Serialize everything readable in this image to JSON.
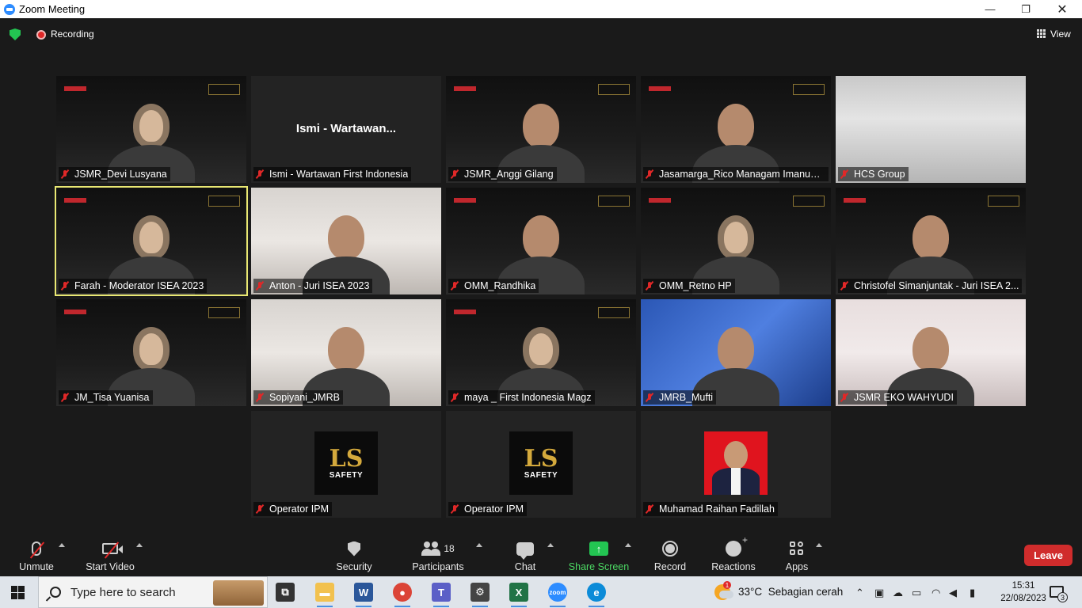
{
  "window": {
    "title": "Zoom Meeting",
    "minimize": "—",
    "maximize": "❐",
    "close": "✕"
  },
  "topbar": {
    "recording_label": "Recording",
    "view_label": "View"
  },
  "participants": [
    {
      "name": "JSMR_Devi Lusyana",
      "style": "video"
    },
    {
      "name": "Ismi - Wartawan First Indonesia",
      "style": "plain",
      "center_text": "Ismi - Wartawan..."
    },
    {
      "name": "JSMR_Anggi Gilang",
      "style": "video"
    },
    {
      "name": "Jasamarga_Rico Managam Imanuel...",
      "style": "video"
    },
    {
      "name": "HCS Group",
      "style": "room"
    },
    {
      "name": "Farah - Moderator ISEA 2023",
      "style": "video",
      "active": true
    },
    {
      "name": "Anton - Juri ISEA 2023",
      "style": "light"
    },
    {
      "name": "OMM_Randhika",
      "style": "video"
    },
    {
      "name": "OMM_Retno HP",
      "style": "video"
    },
    {
      "name": "Christofel Simanjuntak - Juri ISEA 2...",
      "style": "video"
    },
    {
      "name": "JM_Tisa Yuanisa",
      "style": "video"
    },
    {
      "name": "Sopiyani_JMRB",
      "style": "light"
    },
    {
      "name": "maya _ First Indonesia Magz",
      "style": "video"
    },
    {
      "name": "JMRB_Mufti",
      "style": "webinar"
    },
    {
      "name": "JSMR EKO WAHYUDI",
      "style": "office"
    },
    {
      "name": "Operator IPM",
      "style": "logo"
    },
    {
      "name": "Operator IPM",
      "style": "logo"
    },
    {
      "name": "Muhamad Raihan Fadillah",
      "style": "photo"
    }
  ],
  "toolbar": {
    "unmute": "Unmute",
    "start_video": "Start Video",
    "security": "Security",
    "participants": "Participants",
    "participants_count": "18",
    "chat": "Chat",
    "share_screen": "Share Screen",
    "record": "Record",
    "reactions": "Reactions",
    "apps": "Apps",
    "leave": "Leave"
  },
  "taskbar": {
    "search_placeholder": "Type here to search",
    "temperature": "33°C",
    "weather": "Sebagian cerah",
    "weather_badge": "1",
    "time": "15:31",
    "date": "22/08/2023",
    "notification_count": "3",
    "icons": [
      {
        "name": "task-view-icon",
        "glyph": "⧉",
        "color": "#333"
      },
      {
        "name": "file-explorer-icon",
        "glyph": "▬",
        "color": "#f2c14e"
      },
      {
        "name": "word-icon",
        "glyph": "W",
        "color": "#2b579a"
      },
      {
        "name": "chrome-icon",
        "glyph": "●",
        "color": "#db4437"
      },
      {
        "name": "teams-icon",
        "glyph": "T",
        "color": "#5b5fc7"
      },
      {
        "name": "settings-icon",
        "glyph": "⚙",
        "color": "#444"
      },
      {
        "name": "excel-icon",
        "glyph": "X",
        "color": "#217346"
      },
      {
        "name": "zoom-icon",
        "glyph": "zoom",
        "color": "#2d8cff"
      },
      {
        "name": "edge-icon",
        "glyph": "e",
        "color": "#0c8bd8"
      }
    ]
  },
  "colors": {
    "accent": "#2d8cff",
    "leave": "#d02c2c",
    "share_green": "#23c552",
    "mute_red": "#e02828",
    "active_speaker": "#e9e873"
  }
}
